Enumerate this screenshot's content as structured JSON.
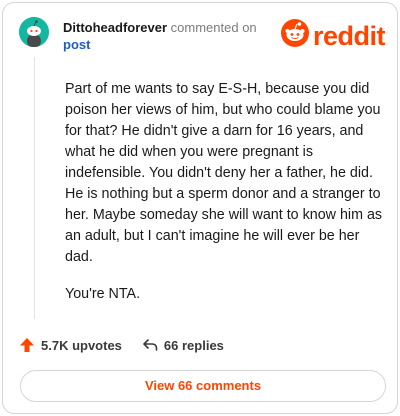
{
  "comment": {
    "username": "Dittoheadforever",
    "action_text": "commented on",
    "target_link": "post",
    "paragraphs": [
      "Part of me wants to say E-S-H, because you did poison her views of him, but who could blame you for that? He didn't give a darn for 16 years, and what he did when you were pregnant is indefensible. You didn't deny her a father, he did. He is nothing but a sperm donor and a stranger to her. Maybe someday she will want to know him as an adult, but I can't imagine he will ever be her dad.",
      "You're NTA."
    ]
  },
  "brand": {
    "name": "reddit",
    "color": "#ff4500"
  },
  "actions": {
    "upvotes_label": "5.7K upvotes",
    "replies_label": "66 replies"
  },
  "view_button": {
    "label": "View 66 comments"
  },
  "colors": {
    "avatar_bg": "#14b8a0",
    "link": "#1f5fbf",
    "accent": "#ff4500"
  },
  "icons": {
    "avatar": "snoo-avatar-icon",
    "logo": "reddit-snoo-icon",
    "upvote": "upvote-arrow-icon",
    "reply": "reply-arrow-icon"
  }
}
